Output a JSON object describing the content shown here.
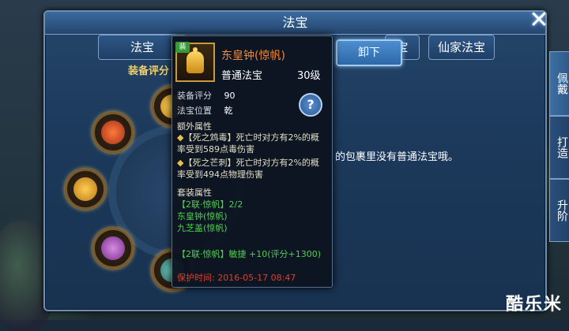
{
  "window": {
    "title": "法宝"
  },
  "tabs": {
    "fabao": "法宝",
    "putong": "宝",
    "xianjia": "仙家法宝"
  },
  "left": {
    "score_label": "装备评分"
  },
  "empty_message": "的包裹里没有普通法宝哦。",
  "side_tabs": [
    {
      "label": "佩戴",
      "active": true
    },
    {
      "label": "打造",
      "active": false
    },
    {
      "label": "升阶",
      "active": false
    }
  ],
  "tooltip": {
    "badge": "装",
    "name": "东皇钟(惊帆)",
    "type": "普通法宝",
    "level": "30级",
    "score_label": "装备评分",
    "score_value": "90",
    "position_label": "法宝位置",
    "position_value": "乾",
    "extra_title": "额外属性",
    "extra_attrs": [
      "【死之鸩毒】死亡时对方有2%的概率受到589点毒伤害",
      "【死之芒刺】死亡时对方有2%的概率受到494点物理伤害"
    ],
    "set_title": "套装属性",
    "set_name": "【2联·惊帆】2/2",
    "set_items": [
      "东皇钟(惊帆)",
      "九芝盖(惊帆)"
    ],
    "set_bonus": "【2联·惊帆】敏捷 +10(评分+1300)",
    "protect_time": "保护时间: 2016-05-17 08:47",
    "help_symbol": "?"
  },
  "unequip_button": "卸下",
  "watermark": "酷乐米",
  "colors": {
    "name": "#f08a3a",
    "green": "#4cd14c",
    "red": "#d6432c",
    "accent": "#4d8ed0"
  }
}
